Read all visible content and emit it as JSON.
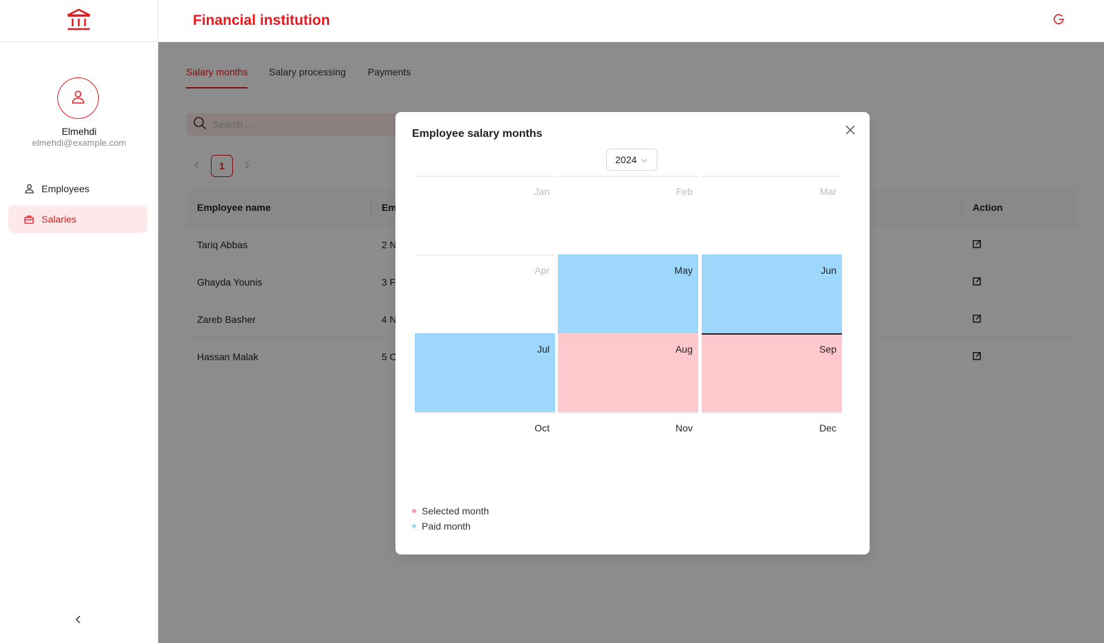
{
  "app": {
    "title": "Financial institution",
    "logo_icon": "bank-icon",
    "logout_icon": "logout-icon"
  },
  "user": {
    "name": "Elmehdi",
    "email": "elmehdi@example.com"
  },
  "sidebar": {
    "items": [
      {
        "label": "Employees",
        "icon": "user-icon",
        "active": false
      },
      {
        "label": "Salaries",
        "icon": "briefcase-icon",
        "active": true
      }
    ]
  },
  "tabs": [
    {
      "label": "Salary months",
      "active": true
    },
    {
      "label": "Salary processing",
      "active": false
    },
    {
      "label": "Payments",
      "active": false
    }
  ],
  "search": {
    "placeholder": "Search ..."
  },
  "pagination": {
    "current": "1"
  },
  "table": {
    "headers": {
      "name": "Employee name",
      "second": "Em",
      "action": "Action"
    },
    "rows": [
      {
        "name": "Tariq Abbas",
        "second": "2 N"
      },
      {
        "name": "Ghayda Younis",
        "second": "3 F"
      },
      {
        "name": "Zareb Basher",
        "second": "4 N"
      },
      {
        "name": "Hassan Malak",
        "second": "5 C"
      }
    ]
  },
  "modal": {
    "title": "Employee salary months",
    "year": "2024",
    "months": [
      {
        "label": "Jan",
        "state": "past"
      },
      {
        "label": "Feb",
        "state": "past"
      },
      {
        "label": "Mar",
        "state": "past"
      },
      {
        "label": "Apr",
        "state": "past"
      },
      {
        "label": "May",
        "state": "paid"
      },
      {
        "label": "Jun",
        "state": "paid"
      },
      {
        "label": "Jul",
        "state": "paid"
      },
      {
        "label": "Aug",
        "state": "selected"
      },
      {
        "label": "Sep",
        "state": "selected"
      },
      {
        "label": "Oct",
        "state": "future"
      },
      {
        "label": "Nov",
        "state": "future"
      },
      {
        "label": "Dec",
        "state": "future"
      }
    ],
    "legend": [
      {
        "label": "Selected month",
        "color": "#f59ca5"
      },
      {
        "label": "Paid month",
        "color": "#9dd8fc"
      }
    ]
  },
  "colors": {
    "accent": "#e8191e",
    "paid": "#9dd8fc",
    "selected": "#fec8cd"
  }
}
